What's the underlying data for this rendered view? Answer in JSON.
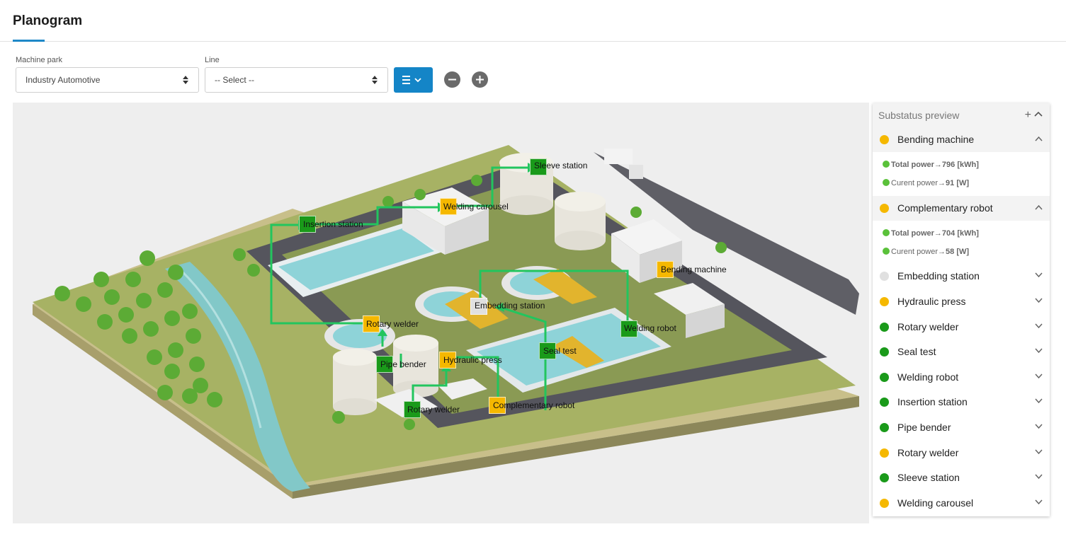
{
  "header": {
    "title": "Planogram"
  },
  "filters": {
    "machine_park_label": "Machine park",
    "machine_park_value": "Industry Automotive",
    "line_label": "Line",
    "line_value": "-- Select --"
  },
  "colors": {
    "accent": "#1485c7",
    "ok": "#1a9a1a",
    "warning": "#f5b800",
    "idle": "#e0e0e0",
    "metric": "#5ac13a"
  },
  "map": {
    "machines": [
      {
        "label": "Sleeve station",
        "status": "green"
      },
      {
        "label": "Welding carousel",
        "status": "yellow"
      },
      {
        "label": "Insertion station",
        "status": "green"
      },
      {
        "label": "Bending machine",
        "status": "yellow"
      },
      {
        "label": "Embedding station",
        "status": "grey"
      },
      {
        "label": "Rotary welder",
        "status": "yellow"
      },
      {
        "label": "Welding robot",
        "status": "green"
      },
      {
        "label": "Seal test",
        "status": "green"
      },
      {
        "label": "Pipe bender",
        "status": "green"
      },
      {
        "label": "Hydraulic press",
        "status": "yellow"
      },
      {
        "label": "Rotary welder",
        "status": "green"
      },
      {
        "label": "Complementary robot",
        "status": "yellow"
      }
    ]
  },
  "panel": {
    "title": "Substatus preview",
    "items": [
      {
        "label": "Bending machine",
        "status": "yellow",
        "expanded": true,
        "metrics": [
          {
            "name": "Total power",
            "value": "796 [kWh]"
          },
          {
            "name": "Curent power",
            "value": "91 [W]"
          }
        ]
      },
      {
        "label": "Complementary robot",
        "status": "yellow",
        "expanded": true,
        "metrics": [
          {
            "name": "Total power",
            "value": "704 [kWh]"
          },
          {
            "name": "Curent power",
            "value": "58 [W]"
          }
        ]
      },
      {
        "label": "Embedding station",
        "status": "grey"
      },
      {
        "label": "Hydraulic press",
        "status": "yellow"
      },
      {
        "label": "Rotary welder",
        "status": "green"
      },
      {
        "label": "Seal test",
        "status": "green"
      },
      {
        "label": "Welding robot",
        "status": "green"
      },
      {
        "label": "Insertion station",
        "status": "green"
      },
      {
        "label": "Pipe bender",
        "status": "green"
      },
      {
        "label": "Rotary welder",
        "status": "yellow"
      },
      {
        "label": "Sleeve station",
        "status": "green"
      },
      {
        "label": "Welding carousel",
        "status": "yellow"
      }
    ]
  }
}
